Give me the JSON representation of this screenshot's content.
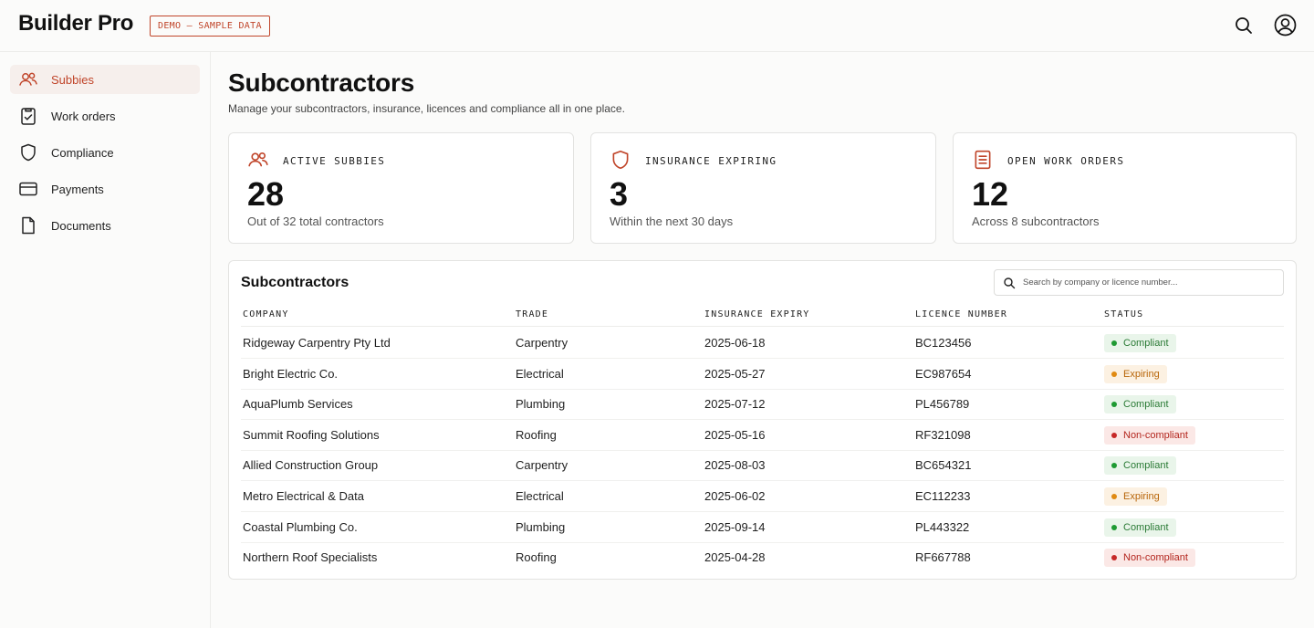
{
  "app": {
    "brand": "Builder Pro",
    "demo_badge": "DEMO — SAMPLE DATA",
    "accent": "#c0452a"
  },
  "sidebar": {
    "items": [
      {
        "label": "Subbies",
        "icon": "users-icon",
        "active": true
      },
      {
        "label": "Work orders",
        "icon": "clipboard-icon",
        "active": false
      },
      {
        "label": "Compliance",
        "icon": "shield-icon",
        "active": false
      },
      {
        "label": "Payments",
        "icon": "credit-card-icon",
        "active": false
      },
      {
        "label": "Documents",
        "icon": "document-icon",
        "active": false
      }
    ]
  },
  "page": {
    "title": "Subcontractors",
    "subtitle": "Manage your subcontractors, insurance, licences and compliance all in one place."
  },
  "stats": [
    {
      "label": "ACTIVE SUBBIES",
      "value": "28",
      "note": "Out of 32 total contractors",
      "icon": "users-icon"
    },
    {
      "label": "INSURANCE EXPIRING",
      "value": "3",
      "note": "Within the next 30 days",
      "icon": "shield-icon"
    },
    {
      "label": "OPEN WORK ORDERS",
      "value": "12",
      "note": "Across 8 subcontractors",
      "icon": "document-list-icon"
    }
  ],
  "table": {
    "title": "Subcontractors",
    "search_placeholder": "Search by company or licence number...",
    "columns": [
      "COMPANY",
      "TRADE",
      "INSURANCE EXPIRY",
      "LICENCE NUMBER",
      "STATUS"
    ],
    "rows": [
      {
        "company": "Ridgeway Carpentry Pty Ltd",
        "trade": "Carpentry",
        "expiry": "2025-06-18",
        "licence": "BC123456",
        "status": "Compliant",
        "status_kind": "compliant"
      },
      {
        "company": "Bright Electric Co.",
        "trade": "Electrical",
        "expiry": "2025-05-27",
        "licence": "EC987654",
        "status": "Expiring",
        "status_kind": "expiring"
      },
      {
        "company": "AquaPlumb Services",
        "trade": "Plumbing",
        "expiry": "2025-07-12",
        "licence": "PL456789",
        "status": "Compliant",
        "status_kind": "compliant"
      },
      {
        "company": "Summit Roofing Solutions",
        "trade": "Roofing",
        "expiry": "2025-05-16",
        "licence": "RF321098",
        "status": "Non-compliant",
        "status_kind": "noncompliant"
      },
      {
        "company": "Allied Construction Group",
        "trade": "Carpentry",
        "expiry": "2025-08-03",
        "licence": "BC654321",
        "status": "Compliant",
        "status_kind": "compliant"
      },
      {
        "company": "Metro Electrical & Data",
        "trade": "Electrical",
        "expiry": "2025-06-02",
        "licence": "EC112233",
        "status": "Expiring",
        "status_kind": "expiring"
      },
      {
        "company": "Coastal Plumbing Co.",
        "trade": "Plumbing",
        "expiry": "2025-09-14",
        "licence": "PL443322",
        "status": "Compliant",
        "status_kind": "compliant"
      },
      {
        "company": "Northern Roof Specialists",
        "trade": "Roofing",
        "expiry": "2025-04-28",
        "licence": "RF667788",
        "status": "Non-compliant",
        "status_kind": "noncompliant"
      }
    ]
  }
}
